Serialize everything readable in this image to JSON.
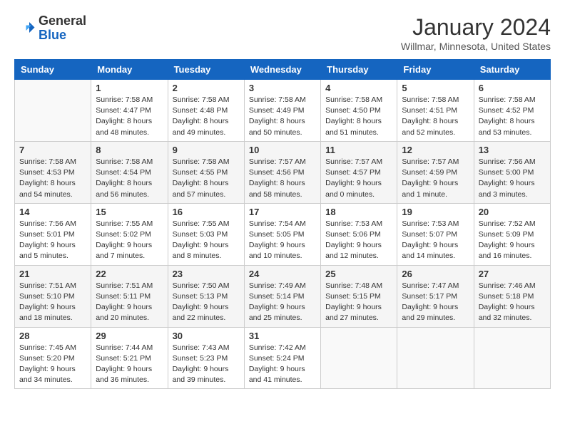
{
  "header": {
    "logo_line1": "General",
    "logo_line2": "Blue",
    "title": "January 2024",
    "subtitle": "Willmar, Minnesota, United States"
  },
  "calendar": {
    "days_of_week": [
      "Sunday",
      "Monday",
      "Tuesday",
      "Wednesday",
      "Thursday",
      "Friday",
      "Saturday"
    ],
    "weeks": [
      [
        {
          "date": "",
          "info": ""
        },
        {
          "date": "1",
          "info": "Sunrise: 7:58 AM\nSunset: 4:47 PM\nDaylight: 8 hours\nand 48 minutes."
        },
        {
          "date": "2",
          "info": "Sunrise: 7:58 AM\nSunset: 4:48 PM\nDaylight: 8 hours\nand 49 minutes."
        },
        {
          "date": "3",
          "info": "Sunrise: 7:58 AM\nSunset: 4:49 PM\nDaylight: 8 hours\nand 50 minutes."
        },
        {
          "date": "4",
          "info": "Sunrise: 7:58 AM\nSunset: 4:50 PM\nDaylight: 8 hours\nand 51 minutes."
        },
        {
          "date": "5",
          "info": "Sunrise: 7:58 AM\nSunset: 4:51 PM\nDaylight: 8 hours\nand 52 minutes."
        },
        {
          "date": "6",
          "info": "Sunrise: 7:58 AM\nSunset: 4:52 PM\nDaylight: 8 hours\nand 53 minutes."
        }
      ],
      [
        {
          "date": "7",
          "info": "Sunrise: 7:58 AM\nSunset: 4:53 PM\nDaylight: 8 hours\nand 54 minutes."
        },
        {
          "date": "8",
          "info": "Sunrise: 7:58 AM\nSunset: 4:54 PM\nDaylight: 8 hours\nand 56 minutes."
        },
        {
          "date": "9",
          "info": "Sunrise: 7:58 AM\nSunset: 4:55 PM\nDaylight: 8 hours\nand 57 minutes."
        },
        {
          "date": "10",
          "info": "Sunrise: 7:57 AM\nSunset: 4:56 PM\nDaylight: 8 hours\nand 58 minutes."
        },
        {
          "date": "11",
          "info": "Sunrise: 7:57 AM\nSunset: 4:57 PM\nDaylight: 9 hours\nand 0 minutes."
        },
        {
          "date": "12",
          "info": "Sunrise: 7:57 AM\nSunset: 4:59 PM\nDaylight: 9 hours\nand 1 minute."
        },
        {
          "date": "13",
          "info": "Sunrise: 7:56 AM\nSunset: 5:00 PM\nDaylight: 9 hours\nand 3 minutes."
        }
      ],
      [
        {
          "date": "14",
          "info": "Sunrise: 7:56 AM\nSunset: 5:01 PM\nDaylight: 9 hours\nand 5 minutes."
        },
        {
          "date": "15",
          "info": "Sunrise: 7:55 AM\nSunset: 5:02 PM\nDaylight: 9 hours\nand 7 minutes."
        },
        {
          "date": "16",
          "info": "Sunrise: 7:55 AM\nSunset: 5:03 PM\nDaylight: 9 hours\nand 8 minutes."
        },
        {
          "date": "17",
          "info": "Sunrise: 7:54 AM\nSunset: 5:05 PM\nDaylight: 9 hours\nand 10 minutes."
        },
        {
          "date": "18",
          "info": "Sunrise: 7:53 AM\nSunset: 5:06 PM\nDaylight: 9 hours\nand 12 minutes."
        },
        {
          "date": "19",
          "info": "Sunrise: 7:53 AM\nSunset: 5:07 PM\nDaylight: 9 hours\nand 14 minutes."
        },
        {
          "date": "20",
          "info": "Sunrise: 7:52 AM\nSunset: 5:09 PM\nDaylight: 9 hours\nand 16 minutes."
        }
      ],
      [
        {
          "date": "21",
          "info": "Sunrise: 7:51 AM\nSunset: 5:10 PM\nDaylight: 9 hours\nand 18 minutes."
        },
        {
          "date": "22",
          "info": "Sunrise: 7:51 AM\nSunset: 5:11 PM\nDaylight: 9 hours\nand 20 minutes."
        },
        {
          "date": "23",
          "info": "Sunrise: 7:50 AM\nSunset: 5:13 PM\nDaylight: 9 hours\nand 22 minutes."
        },
        {
          "date": "24",
          "info": "Sunrise: 7:49 AM\nSunset: 5:14 PM\nDaylight: 9 hours\nand 25 minutes."
        },
        {
          "date": "25",
          "info": "Sunrise: 7:48 AM\nSunset: 5:15 PM\nDaylight: 9 hours\nand 27 minutes."
        },
        {
          "date": "26",
          "info": "Sunrise: 7:47 AM\nSunset: 5:17 PM\nDaylight: 9 hours\nand 29 minutes."
        },
        {
          "date": "27",
          "info": "Sunrise: 7:46 AM\nSunset: 5:18 PM\nDaylight: 9 hours\nand 32 minutes."
        }
      ],
      [
        {
          "date": "28",
          "info": "Sunrise: 7:45 AM\nSunset: 5:20 PM\nDaylight: 9 hours\nand 34 minutes."
        },
        {
          "date": "29",
          "info": "Sunrise: 7:44 AM\nSunset: 5:21 PM\nDaylight: 9 hours\nand 36 minutes."
        },
        {
          "date": "30",
          "info": "Sunrise: 7:43 AM\nSunset: 5:23 PM\nDaylight: 9 hours\nand 39 minutes."
        },
        {
          "date": "31",
          "info": "Sunrise: 7:42 AM\nSunset: 5:24 PM\nDaylight: 9 hours\nand 41 minutes."
        },
        {
          "date": "",
          "info": ""
        },
        {
          "date": "",
          "info": ""
        },
        {
          "date": "",
          "info": ""
        }
      ]
    ]
  }
}
